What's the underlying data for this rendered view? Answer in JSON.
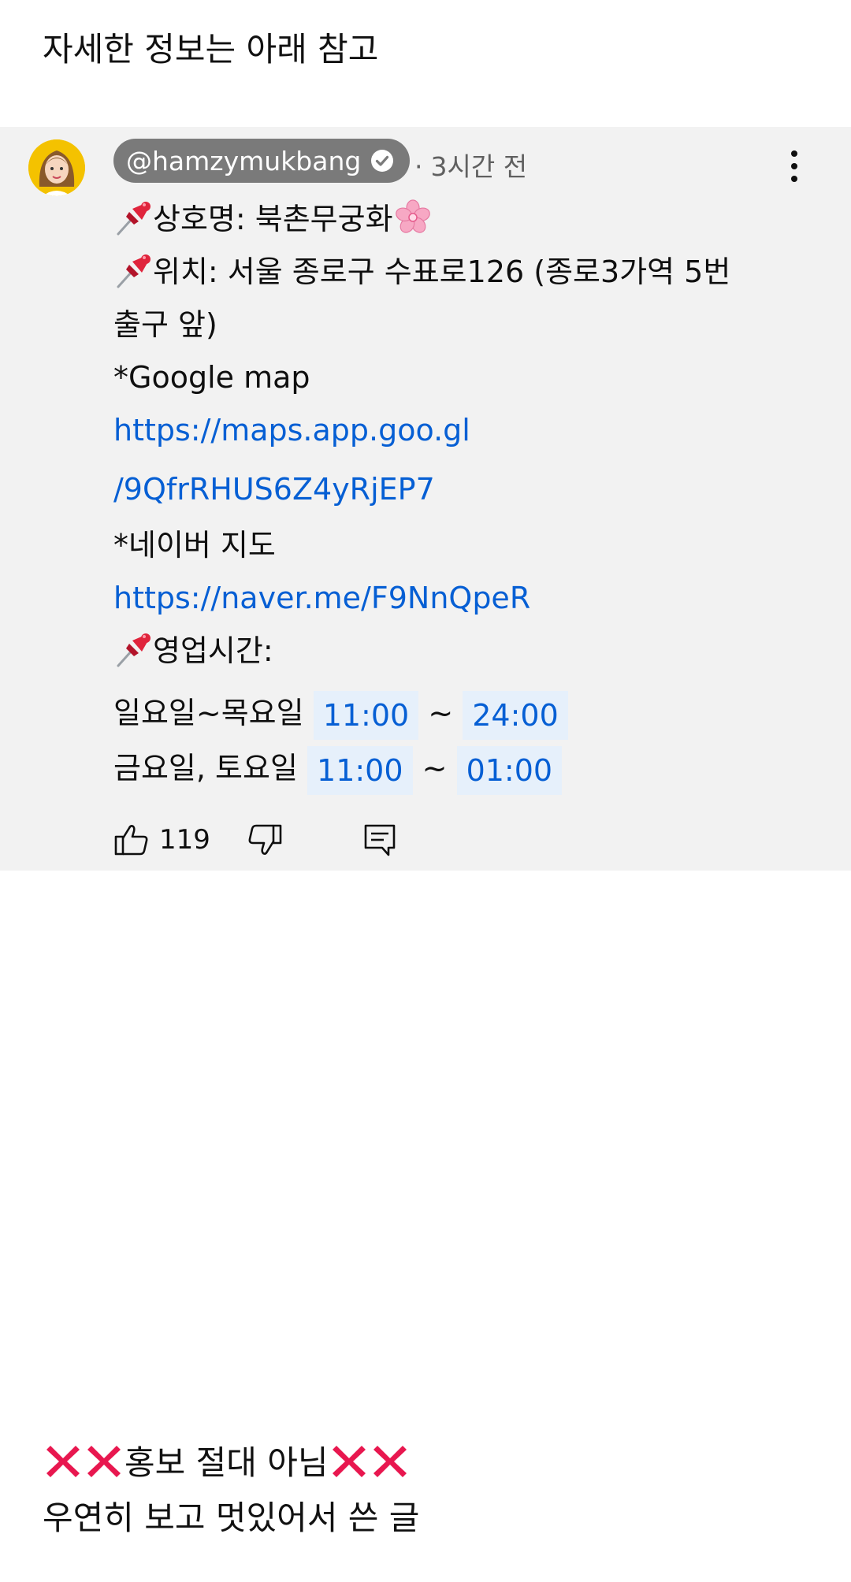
{
  "intro_text": "자세한 정보는 아래 참고",
  "comment": {
    "handle": "@hamzymukbang",
    "time": "3시간 전",
    "lines": {
      "name": "상호명: 북촌무궁화",
      "location_1": "위치: 서울 종로구 수표로126 (종로3가역 5번",
      "location_2": "출구 앞)",
      "google_label": "*Google map",
      "google_link_1": "https://maps.app.goo.gl",
      "google_link_2": "/9QfrRHUS6Z4yRjEP7",
      "naver_label": "*네이버 지도",
      "naver_link": "https://naver.me/F9NnQpeR",
      "hours_label": "영업시간:"
    },
    "hours": [
      {
        "days": "일요일~목요일",
        "open": "11:00",
        "sep": "~",
        "close": "24:00"
      },
      {
        "days": "금요일, 토요일",
        "open": "11:00",
        "sep": "~",
        "close": "01:00"
      }
    ],
    "like_count": "119",
    "icons": {
      "pin": "pushpin-icon",
      "blossom": "cherry-blossom-icon",
      "verified": "verified-check-icon",
      "like": "thumbs-up-icon",
      "dislike": "thumbs-down-icon",
      "reply": "reply-icon",
      "more": "more-vert-icon"
    }
  },
  "outro": {
    "line1": "홍보 절대 아님",
    "line2": "우연히 보고 멋있어서 쓴 글"
  },
  "colors": {
    "link": "#065fd4",
    "card_bg": "#f2f2f2",
    "handle_bg": "#7a7a7a",
    "chip_bg": "#e6f0fb",
    "x_red": "#e8174f"
  }
}
